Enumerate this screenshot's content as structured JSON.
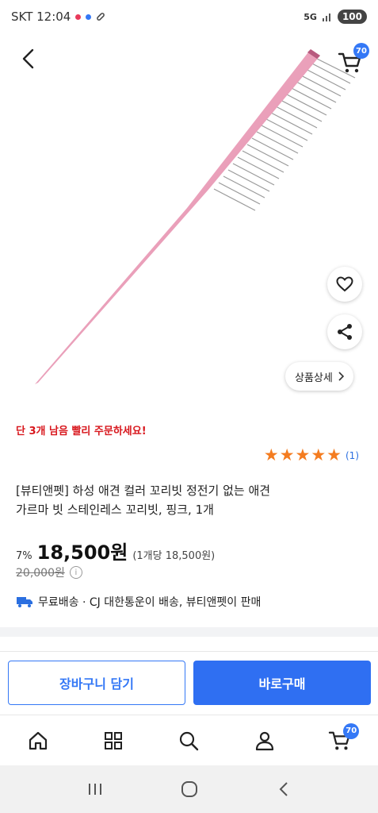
{
  "status_bar": {
    "carrier_time": "SKT 12:04",
    "network": "5G",
    "battery": "100"
  },
  "header": {
    "cart_badge": "70"
  },
  "actions": {
    "detail_label": "상품상세"
  },
  "stock_alert": "단 3개 남음 빨리 주문하세요!",
  "rating": {
    "stars": 5,
    "count": "(1)"
  },
  "product": {
    "title_line1": "[뷰티앤펫] 하성 애견 컬러 꼬리빗 정전기 없는 애견",
    "title_line2": "가르마 빗 스테인레스 꼬리빗, 핑크, 1개",
    "discount": "7%",
    "price": "18,500원",
    "unit_price": "(1개당 18,500원)",
    "original_price": "20,000원",
    "shipping": "무료배송 · CJ 대한통운이 배송, 뷰티앤펫이 판매"
  },
  "cta": {
    "cart_button": "장바구니 담기",
    "buy_button": "바로구매"
  },
  "bottom_nav": {
    "cart_badge": "70"
  },
  "colors": {
    "accent": "#2f6ff2",
    "alert": "#d8171d",
    "star": "#f47c20"
  }
}
